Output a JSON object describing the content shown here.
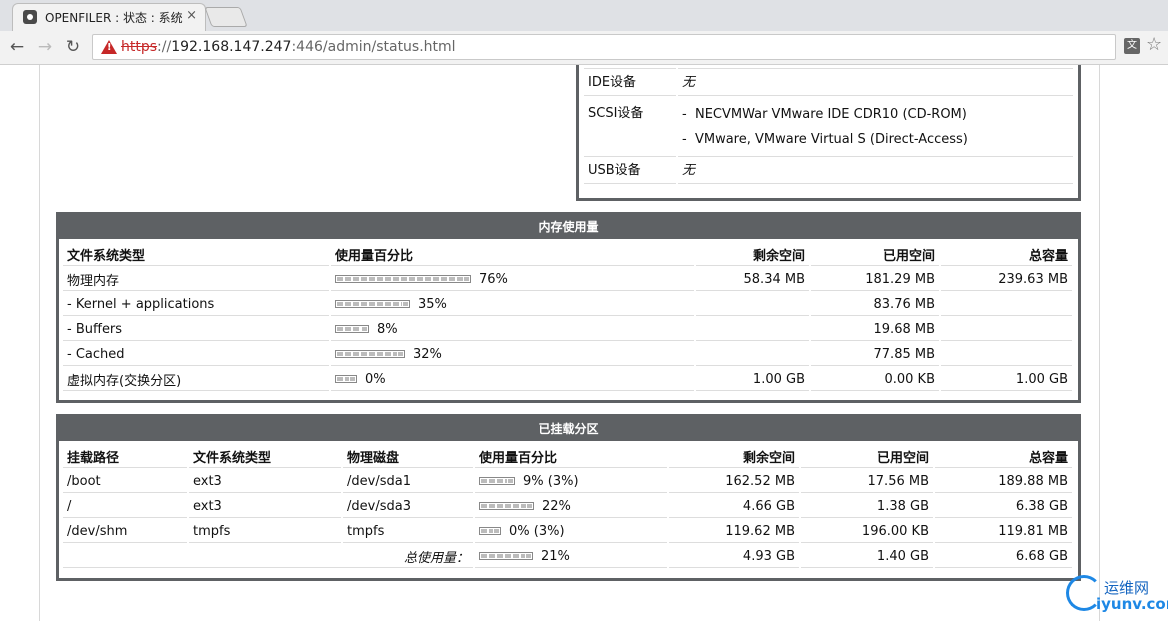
{
  "browser": {
    "tab_title": "OPENFILER : 状态 : 系统",
    "tab_close": "×",
    "url_scheme": "https",
    "url_sep": "://",
    "url_host": "192.168.147.247",
    "url_port": ":446",
    "url_path": "/admin/status.html",
    "nav_back": "←",
    "nav_forward": "→",
    "nav_reload": "↻",
    "translate_glyph": "文",
    "star_glyph": "☆"
  },
  "hardware": {
    "rows": [
      {
        "label": "IDE设备",
        "items": [
          "无"
        ]
      },
      {
        "label": "SCSI设备",
        "items": [
          "NECVMWar VMware IDE CDR10 (CD-ROM)",
          "VMware, VMware Virtual S (Direct-Access)"
        ]
      },
      {
        "label": "USB设备",
        "items": [
          "无"
        ]
      }
    ],
    "dash": "-"
  },
  "memory": {
    "title": "内存使用量",
    "headers": [
      "文件系统类型",
      "使用量百分比",
      "剩余空间",
      "已用空间",
      "总容量"
    ],
    "rows": [
      {
        "name": "物理内存",
        "percent": "76%",
        "pct_value": 76,
        "free": "58.34 MB",
        "used": "181.29 MB",
        "total": "239.63 MB"
      },
      {
        "name": "- Kernel + applications",
        "percent": "35%",
        "pct_value": 35,
        "free": "",
        "used": "83.76 MB",
        "total": ""
      },
      {
        "name": "- Buffers",
        "percent": "8%",
        "pct_value": 8,
        "free": "",
        "used": "19.68 MB",
        "total": ""
      },
      {
        "name": "- Cached",
        "percent": "32%",
        "pct_value": 32,
        "free": "",
        "used": "77.85 MB",
        "total": ""
      },
      {
        "name": "虚拟内存(交换分区)",
        "percent": "0%",
        "pct_value": 0,
        "free": "1.00 GB",
        "used": "0.00 KB",
        "total": "1.00 GB"
      }
    ]
  },
  "mounts": {
    "title": "已挂载分区",
    "headers": [
      "挂载路径",
      "文件系统类型",
      "物理磁盘",
      "使用量百分比",
      "剩余空间",
      "已用空间",
      "总容量"
    ],
    "rows": [
      {
        "path": "/boot",
        "fs": "ext3",
        "disk": "/dev/sda1",
        "percent": "9% (3%)",
        "pct_value": 9,
        "free": "162.52 MB",
        "used": "17.56 MB",
        "total": "189.88 MB"
      },
      {
        "path": "/",
        "fs": "ext3",
        "disk": "/dev/sda3",
        "percent": "22%",
        "pct_value": 22,
        "free": "4.66 GB",
        "used": "1.38 GB",
        "total": "6.38 GB"
      },
      {
        "path": "/dev/shm",
        "fs": "tmpfs",
        "disk": "tmpfs",
        "percent": "0% (3%)",
        "pct_value": 0,
        "free": "119.62 MB",
        "used": "196.00 KB",
        "total": "119.81 MB"
      }
    ],
    "total_row": {
      "label": "总使用量：",
      "percent": "21%",
      "pct_value": 21,
      "free": "4.93 GB",
      "used": "1.40 GB",
      "total": "6.68 GB"
    }
  },
  "watermark": {
    "cn": "运维网",
    "url": "iyunv.com"
  },
  "colors": {
    "panel_header": "#5e6164",
    "warning": "#c62828"
  }
}
